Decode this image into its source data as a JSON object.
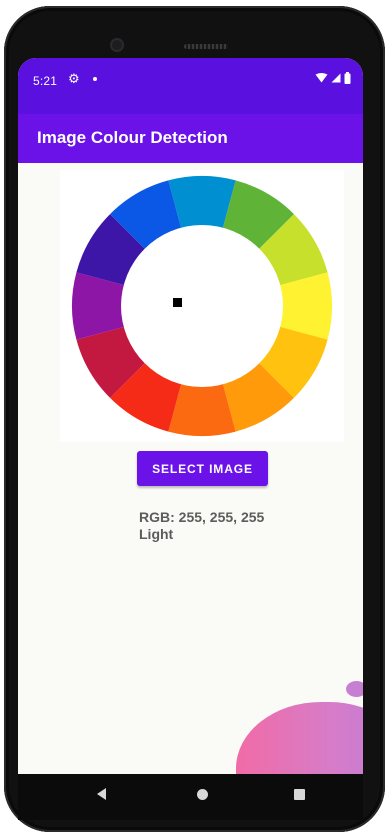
{
  "status_bar": {
    "time": "5:21",
    "icons": [
      "gear-icon",
      "notification-dot-icon",
      "wifi-icon",
      "signal-icon",
      "battery-icon"
    ]
  },
  "app_bar": {
    "title": "Image Colour Detection"
  },
  "image": {
    "description_icon": "color-wheel-image",
    "marker_icon": "selection-marker-icon"
  },
  "actions": {
    "select_image_label": "SELECT IMAGE"
  },
  "result": {
    "rgb_text": "RGB: 255, 255, 255",
    "brightness_text": "Light"
  },
  "nav_bar": {
    "icons": [
      "back-icon",
      "home-icon",
      "recents-icon"
    ]
  },
  "colors": {
    "status_bar": "#5a10df",
    "app_bar": "#6a12e8",
    "button": "#6a12e8",
    "background": "#fafaf7",
    "text": "#5c5c5c"
  }
}
